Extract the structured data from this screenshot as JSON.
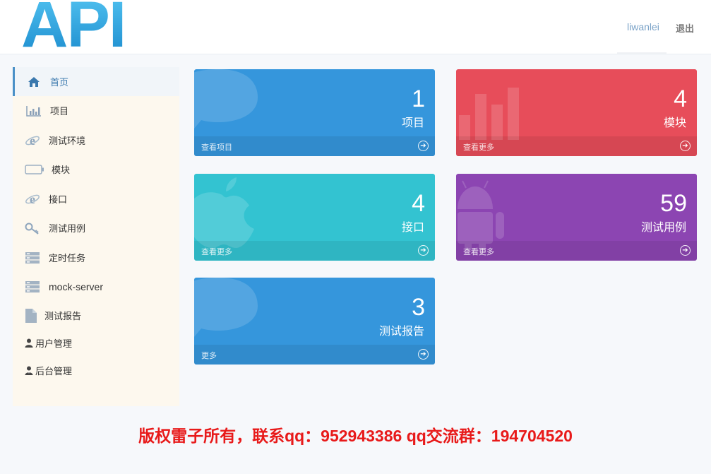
{
  "header": {
    "logo_text": "API",
    "username": "liwanlei",
    "logout": "退出"
  },
  "sidebar": {
    "items": [
      {
        "label": "首页",
        "icon": "home-icon"
      },
      {
        "label": "项目",
        "icon": "bar-chart-icon"
      },
      {
        "label": "测试环境",
        "icon": "ie-browser-icon"
      },
      {
        "label": "模块",
        "icon": "battery-icon"
      },
      {
        "label": "接口",
        "icon": "ie-browser-icon"
      },
      {
        "label": "测试用例",
        "icon": "key-icon"
      },
      {
        "label": "定时任务",
        "icon": "server-icon"
      },
      {
        "label": "mock-server",
        "icon": "server-icon"
      },
      {
        "label": "测试报告",
        "icon": "file-icon"
      },
      {
        "label": "用户管理",
        "icon": "user-icon"
      },
      {
        "label": "后台管理",
        "icon": "admin-icon"
      }
    ]
  },
  "cards": [
    {
      "count": "1",
      "label": "项目",
      "more": "查看项目",
      "color": "#3596dc",
      "bg_icon": "chat-bubble-icon"
    },
    {
      "count": "4",
      "label": "模块",
      "more": "查看更多",
      "color": "#e74d5a",
      "bg_icon": "bar-chart-icon"
    },
    {
      "count": "4",
      "label": "接口",
      "more": "查看更多",
      "color": "#33c3d1",
      "bg_icon": "apple-icon"
    },
    {
      "count": "59",
      "label": "测试用例",
      "more": "查看更多",
      "color": "#8c45b2",
      "bg_icon": "android-icon"
    },
    {
      "count": "3",
      "label": "测试报告",
      "more": "更多",
      "color": "#3596dc",
      "bg_icon": "chat-bubble-icon"
    }
  ],
  "footer": {
    "copyright": "版权雷子所有，联系qq：952943386 qq交流群：194704520"
  }
}
